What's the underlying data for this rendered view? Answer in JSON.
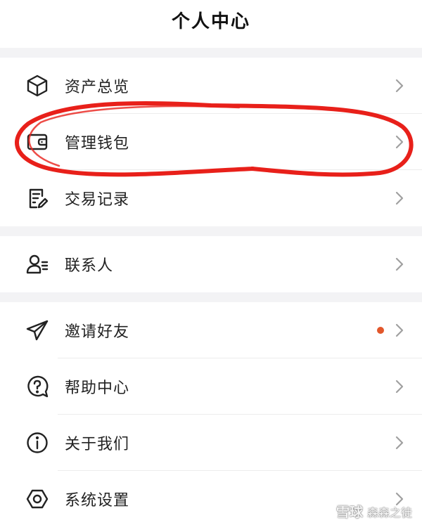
{
  "header": {
    "title": "个人中心"
  },
  "menu": {
    "assets": "资产总览",
    "wallet": "管理钱包",
    "transactions": "交易记录",
    "contacts": "联系人",
    "invite": "邀请好友",
    "help": "帮助中心",
    "about": "关于我们",
    "settings": "系统设置"
  },
  "colors": {
    "background": "#ffffff",
    "section_gap": "#f3f3f5",
    "divider": "#ececec",
    "chevron": "#a0a0a0",
    "icon": "#222222",
    "notification_dot": "#e2572b",
    "annotation_circle": "#e8201a"
  },
  "icons": {
    "assets": "cube-icon",
    "wallet": "wallet-icon",
    "transactions": "document-edit-icon",
    "contacts": "contact-list-icon",
    "invite": "paper-plane-icon",
    "help": "question-bubble-icon",
    "about": "info-icon",
    "settings": "hexagon-gear-icon",
    "row_chevron": "chevron-right-icon"
  },
  "badges": {
    "invite_has_notification": true
  },
  "watermark": {
    "brand": "雪球",
    "author": "森森之徒"
  }
}
